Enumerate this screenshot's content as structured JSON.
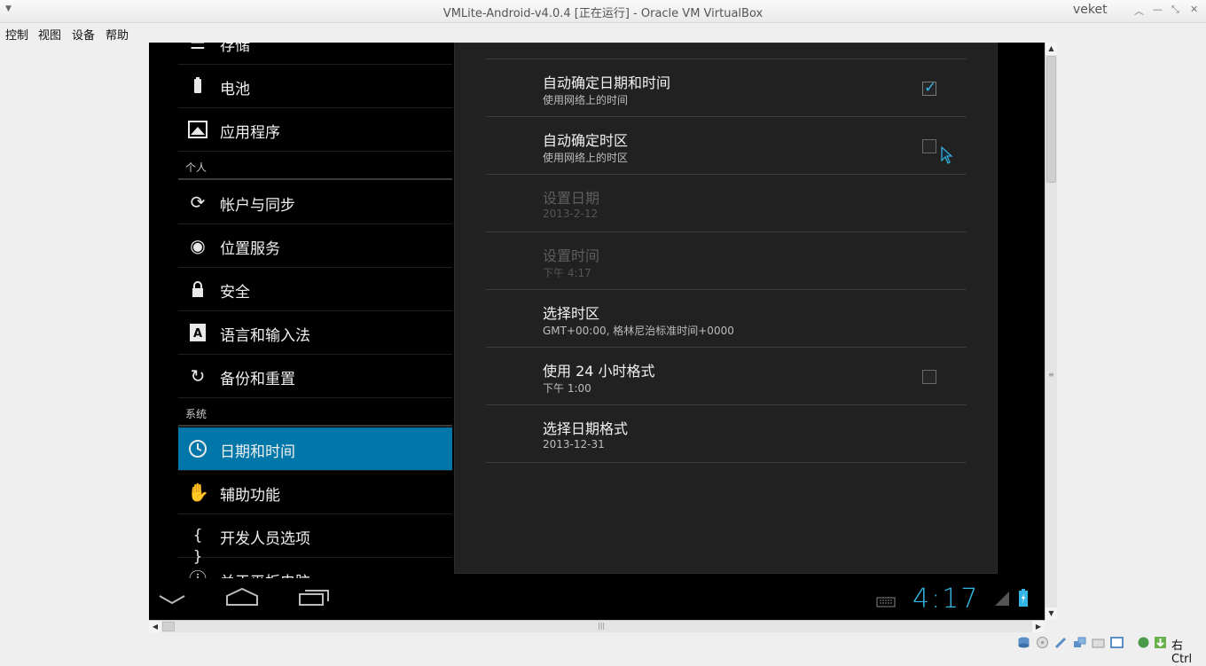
{
  "window": {
    "title": "VMLite-Android-v4.0.4 [正在运行] - Oracle VM VirtualBox",
    "user": "veket"
  },
  "menu": [
    "控制",
    "视图",
    "设备",
    "帮助"
  ],
  "settings_list": {
    "partial_top": "存储",
    "items_device": [
      {
        "label": "电池",
        "icon": "battery-icon"
      },
      {
        "label": "应用程序",
        "icon": "apps-icon"
      }
    ],
    "section_personal": "个人",
    "items_personal": [
      {
        "label": "帐户与同步",
        "icon": "sync-icon"
      },
      {
        "label": "位置服务",
        "icon": "location-icon"
      },
      {
        "label": "安全",
        "icon": "lock-icon"
      },
      {
        "label": "语言和输入法",
        "icon": "language-icon"
      },
      {
        "label": "备份和重置",
        "icon": "backup-icon"
      }
    ],
    "section_system": "系统",
    "items_system": [
      {
        "label": "日期和时间",
        "icon": "clock-icon",
        "active": true
      },
      {
        "label": "辅助功能",
        "icon": "hand-icon"
      },
      {
        "label": "开发人员选项",
        "icon": "braces-icon"
      },
      {
        "label": "关于平板电脑",
        "icon": "info-icon"
      }
    ]
  },
  "datetime": {
    "auto_datetime": {
      "title": "自动确定日期和时间",
      "summary": "使用网络上的时间",
      "checked": true
    },
    "auto_timezone": {
      "title": "自动确定时区",
      "summary": "使用网络上的时区",
      "checked": false
    },
    "set_date": {
      "title": "设置日期",
      "summary": "2013-2-12"
    },
    "set_time": {
      "title": "设置时间",
      "summary": "下午 4:17"
    },
    "select_timezone": {
      "title": "选择时区",
      "summary": "GMT+00:00, 格林尼治标准时间+0000"
    },
    "use_24h": {
      "title": "使用 24 小时格式",
      "summary": "下午 1:00",
      "checked": false
    },
    "date_format": {
      "title": "选择日期格式",
      "summary": "2013-12-31"
    }
  },
  "navbar": {
    "clock": "4:17"
  },
  "statusbar": {
    "host_key": "右 Ctrl"
  },
  "colors": {
    "accent": "#33b5e5",
    "active_row": "#0077a8"
  }
}
